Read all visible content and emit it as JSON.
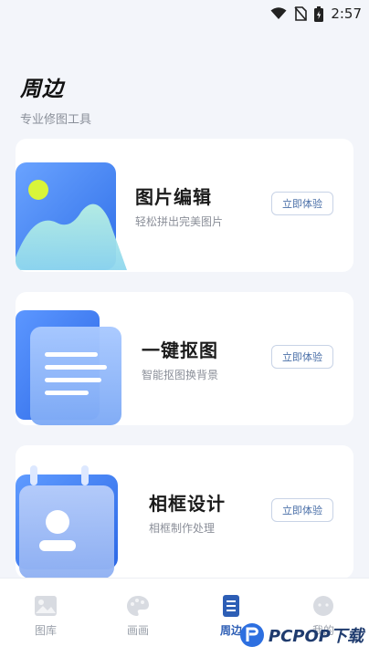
{
  "status_bar": {
    "time": "2:57",
    "icons": [
      "wifi-icon",
      "no-sim-icon",
      "battery-icon"
    ]
  },
  "header": {
    "title": "周边",
    "subtitle": "专业修图工具"
  },
  "cards": [
    {
      "title": "图片编辑",
      "desc": "轻松拼出完美图片",
      "button": "立即体验",
      "icon": "image-edit-icon"
    },
    {
      "title": "一键抠图",
      "desc": "智能抠图换背景",
      "button": "立即体验",
      "icon": "document-cutout-icon"
    },
    {
      "title": "相框设计",
      "desc": "相框制作处理",
      "button": "立即体验",
      "icon": "photo-frame-icon"
    }
  ],
  "tabs": [
    {
      "label": "图库",
      "icon": "gallery-icon",
      "active": false
    },
    {
      "label": "画画",
      "icon": "palette-icon",
      "active": false
    },
    {
      "label": "周边",
      "icon": "document-icon",
      "active": true
    },
    {
      "label": "我的",
      "icon": "profile-icon",
      "active": false
    }
  ],
  "watermark": {
    "text": "PCPOP下载"
  },
  "colors": {
    "accent": "#2d5eb5",
    "background": "#f3f5fa",
    "card": "#ffffff"
  }
}
